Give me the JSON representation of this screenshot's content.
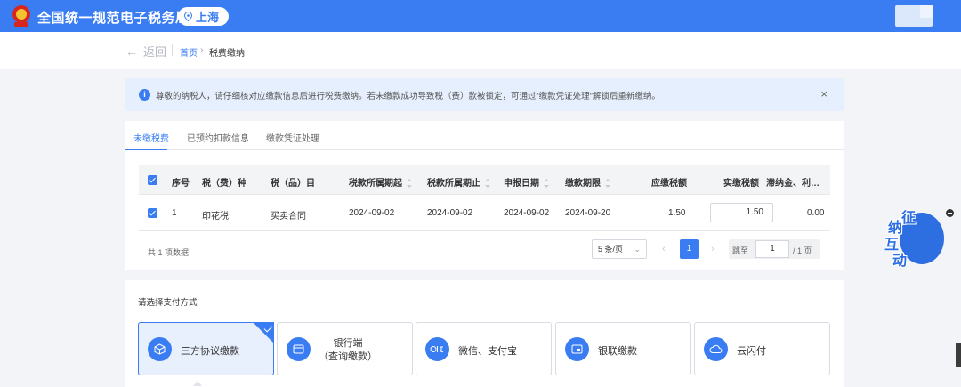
{
  "header": {
    "brand": "全国统一规范电子税务局",
    "region": "上海",
    "icons": [
      "emblem-icon",
      "location-pin-icon",
      "user-avatar"
    ]
  },
  "breadcrumb": {
    "back": "返回",
    "home": "首页",
    "separator": "›",
    "current": "税费缴纳"
  },
  "notice": {
    "text": "尊敬的纳税人，请仔细核对应缴款信息后进行税费缴纳。若未缴款成功导致税（费）款被锁定，可通过“缴款凭证处理”解锁后重新缴纳。",
    "info_glyph": "i",
    "close": "×"
  },
  "tabs": [
    {
      "label": "未缴税费",
      "active": true
    },
    {
      "label": "已预约扣款信息",
      "active": false
    },
    {
      "label": "缴款凭证处理",
      "active": false
    }
  ],
  "table": {
    "columns": [
      "序号",
      "税（费）种",
      "税（品）目",
      "税款所属期起",
      "税款所属期止",
      "申报日期",
      "缴款期限",
      "应缴税额",
      "实缴税额",
      "滞纳金、利…"
    ],
    "rows": [
      {
        "index": "1",
        "tax_type": "印花税",
        "item": "买卖合同",
        "period_start": "2024-09-02",
        "period_end": "2024-09-02",
        "declare_date": "2024-09-02",
        "deadline": "2024-09-20",
        "due": "1.50",
        "paid": "1.50",
        "penalty": "0.00"
      }
    ]
  },
  "pagination": {
    "total_text": "共 1 项数据",
    "page_size": "5 条/页",
    "current_page": "1",
    "prev": "‹",
    "next": "›",
    "jump_label": "跳至",
    "jump_value": "1",
    "total_pages": "/ 1 页"
  },
  "payment": {
    "title": "请选择支付方式",
    "options": [
      {
        "label": "三方协议缴款",
        "selected": true,
        "icon": "box-icon"
      },
      {
        "label_line1": "银行端",
        "label_line2": "（查询缴款）",
        "selected": false,
        "icon": "bank-card-icon"
      },
      {
        "label": "微信、支付宝",
        "selected": false,
        "icon": "wechat-alipay-icon"
      },
      {
        "label": "银联缴款",
        "selected": false,
        "icon": "unionpay-icon"
      },
      {
        "label": "云闪付",
        "selected": false,
        "icon": "cloud-pay-icon"
      }
    ]
  },
  "assistant": {
    "chars": [
      "征",
      "纳",
      "互",
      "动"
    ]
  },
  "colors": {
    "primary": "#3a7df2",
    "notice_bg": "#e6effd",
    "page_bg": "#f2f4f8"
  }
}
